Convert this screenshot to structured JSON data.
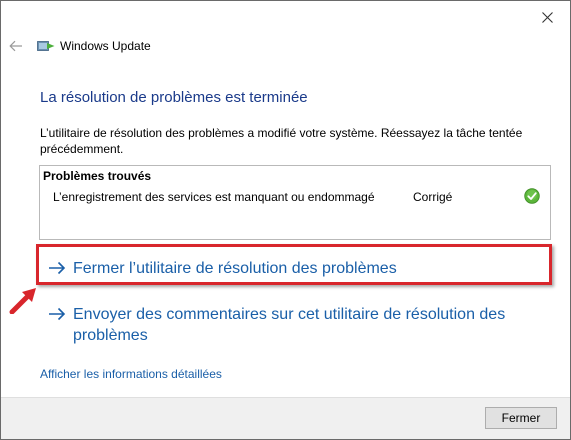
{
  "window": {
    "app_title": "Windows Update",
    "icons": {
      "close": "close-icon",
      "back": "back-arrow-icon",
      "app": "windows-update-icon"
    }
  },
  "content": {
    "heading": "La résolution de problèmes est terminée",
    "description": "L’utilitaire de résolution des problèmes a modifié votre système. Réessayez la tâche tentée précédemment.",
    "problems": {
      "title": "Problèmes trouvés",
      "items": [
        {
          "name": "L’enregistrement des services est manquant ou endommagé",
          "status": "Corrigé",
          "status_icon": "check-circle-icon"
        }
      ]
    },
    "options": {
      "close_troubleshooter": "Fermer l’utilitaire de résolution des problèmes",
      "send_feedback": "Envoyer des commentaires sur cet utilitaire de résolution des problèmes"
    },
    "details_link": "Afficher les informations détaillées"
  },
  "footer": {
    "close_button": "Fermer"
  },
  "colors": {
    "heading": "#1a3a8a",
    "link": "#1a5fa8",
    "highlight": "#d8262c",
    "success": "#5bb53a",
    "footer_bg": "#f0f0f0"
  }
}
